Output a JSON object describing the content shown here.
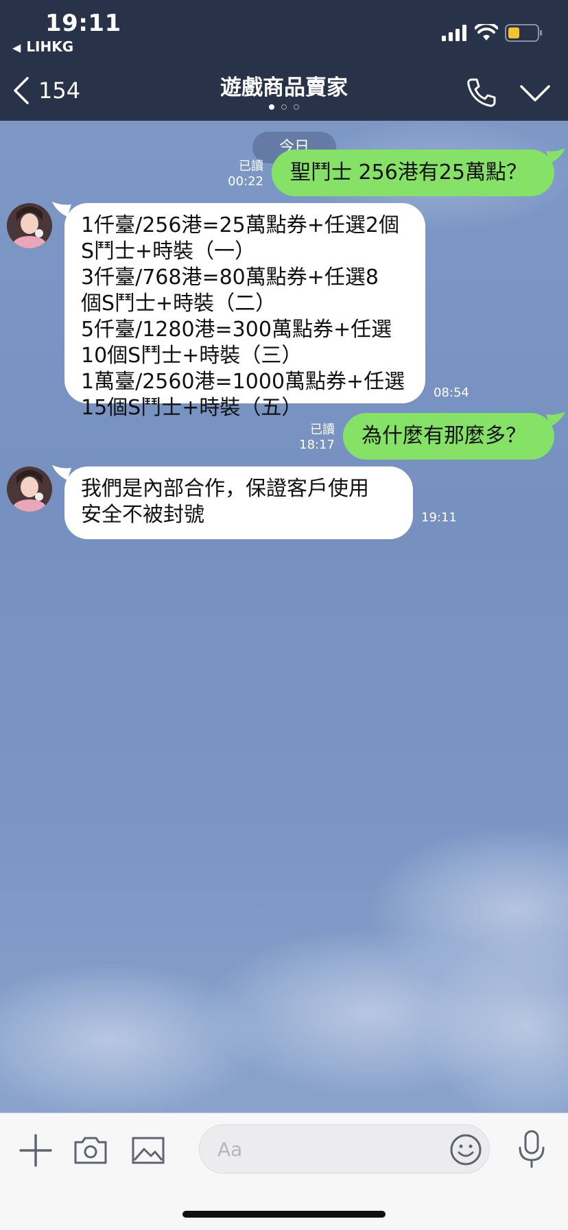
{
  "status_bar": {
    "time": "19:11",
    "back_app": "LIHKG"
  },
  "nav": {
    "back_count": "154",
    "title": "遊戲商品賣家",
    "page_dots": 3,
    "active_dot": 0
  },
  "chat": {
    "date_label": "今日",
    "messages": [
      {
        "dir": "out",
        "lines": [
          "聖鬥士 256港有25萬點？"
        ],
        "read": "已讀",
        "time": "00:22"
      },
      {
        "dir": "in",
        "lines": [
          "1仟臺/256港=25萬點券+任選2個",
          "S鬥士+時裝（一）",
          "3仟臺/768港=80萬點券+任選8",
          "個S鬥士+時裝（二）",
          "5仟臺/1280港=300萬點券+任選",
          "10個S鬥士+時裝（三）",
          "1萬臺/2560港=1000萬點券+任選",
          "15個S鬥士+時裝（五）"
        ],
        "time": "08:54"
      },
      {
        "dir": "out",
        "lines": [
          "為什麼有那麼多？"
        ],
        "read": "已讀",
        "time": "18:17"
      },
      {
        "dir": "in",
        "lines": [
          "我們是內部合作，保證客戶使用",
          "安全不被封號"
        ],
        "time": "19:11"
      }
    ]
  },
  "input": {
    "placeholder": "Aa"
  },
  "colors": {
    "header_bg": "#283248",
    "outgoing_bubble": "#85e266",
    "incoming_bubble": "#ffffff",
    "chat_bg": "#7d96c3"
  },
  "icons": [
    "chevron-left-icon",
    "phone-icon",
    "chevron-down-icon",
    "plus-icon",
    "camera-icon",
    "image-icon",
    "emoji-icon",
    "mic-icon",
    "signal-icon",
    "wifi-icon",
    "battery-icon"
  ]
}
